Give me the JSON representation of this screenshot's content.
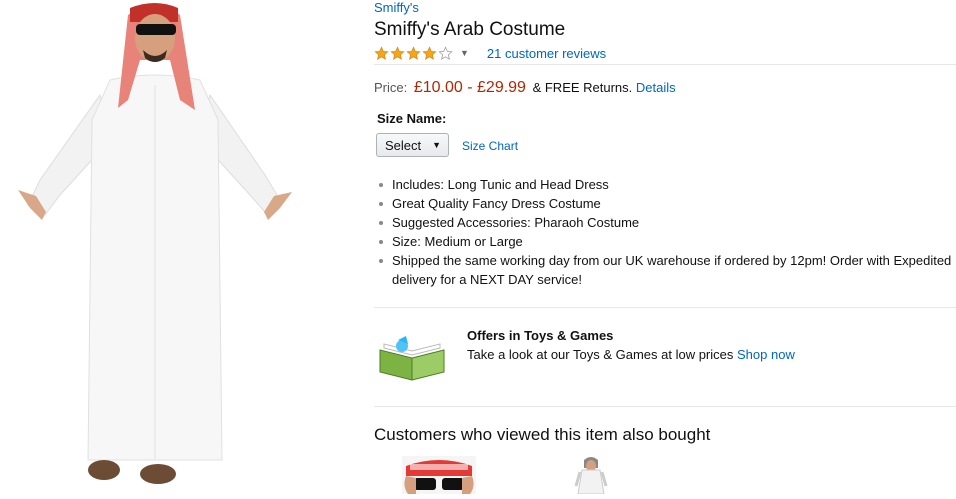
{
  "product": {
    "brand": "Smiffy's",
    "title": "Smiffy's Arab Costume",
    "rating_stars": 4,
    "rating_max": 5,
    "reviews_link": "21 customer reviews"
  },
  "price": {
    "label": "Price:",
    "value": "£10.00 - £29.99",
    "free_returns": "& FREE Returns.",
    "details_link": "Details"
  },
  "size": {
    "label": "Size Name:",
    "select_value": "Select",
    "size_chart_link": "Size Chart"
  },
  "bullets": [
    "Includes: Long Tunic and Head Dress",
    "Great Quality Fancy Dress Costume",
    "Suggested Accessories: Pharaoh Costume",
    "Size: Medium or Large",
    "Shipped the same working day from our UK warehouse if ordered by 12pm! Order with Expedited delivery for a NEXT DAY service!"
  ],
  "offers": {
    "heading": "Offers in Toys & Games",
    "text": "Take a look at our Toys & Games at low prices",
    "link": "Shop now"
  },
  "also_bought": {
    "heading": "Customers who viewed this item also bought"
  },
  "colors": {
    "link": "#0066c0",
    "price": "#b12704",
    "star": "#f4a41d"
  }
}
